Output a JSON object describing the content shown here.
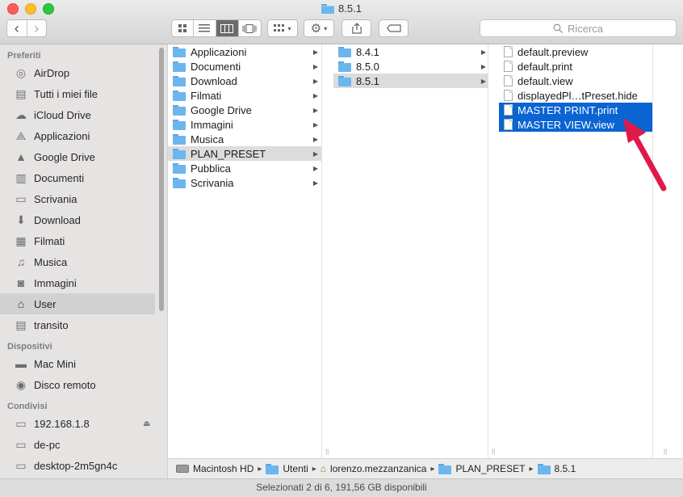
{
  "window": {
    "title": "8.5.1"
  },
  "toolbar": {
    "back": "‹",
    "forward": "›",
    "search_placeholder": "Ricerca"
  },
  "sidebar": {
    "sections": [
      {
        "header": "Preferiti",
        "items": [
          {
            "label": "AirDrop",
            "icon": "airdrop-icon",
            "glyph": "◎"
          },
          {
            "label": "Tutti i miei file",
            "icon": "all-files-icon",
            "glyph": "▤"
          },
          {
            "label": "iCloud Drive",
            "icon": "cloud-icon",
            "glyph": "☁"
          },
          {
            "label": "Applicazioni",
            "icon": "applications-icon",
            "glyph": "⟁"
          },
          {
            "label": "Google Drive",
            "icon": "google-drive-icon",
            "glyph": "▲"
          },
          {
            "label": "Documenti",
            "icon": "documents-icon",
            "glyph": "▥"
          },
          {
            "label": "Scrivania",
            "icon": "desktop-icon",
            "glyph": "▭"
          },
          {
            "label": "Download",
            "icon": "download-icon",
            "glyph": "⬇"
          },
          {
            "label": "Filmati",
            "icon": "movies-icon",
            "glyph": "▦"
          },
          {
            "label": "Musica",
            "icon": "music-icon",
            "glyph": "♫"
          },
          {
            "label": "Immagini",
            "icon": "pictures-icon",
            "glyph": "◙"
          },
          {
            "label": "User",
            "icon": "home-icon",
            "glyph": "⌂"
          },
          {
            "label": "transito",
            "icon": "folder-icon",
            "glyph": "▤"
          }
        ]
      },
      {
        "header": "Dispositivi",
        "items": [
          {
            "label": "Mac Mini",
            "icon": "computer-icon",
            "glyph": "▬"
          },
          {
            "label": "Disco remoto",
            "icon": "remote-disc-icon",
            "glyph": "◉"
          }
        ]
      },
      {
        "header": "Condivisi",
        "items": [
          {
            "label": "192.168.1.8",
            "icon": "network-display-icon",
            "glyph": "▭"
          },
          {
            "label": "de-pc",
            "icon": "network-display-icon",
            "glyph": "▭"
          },
          {
            "label": "desktop-2m5gn4c",
            "icon": "network-display-icon",
            "glyph": "▭"
          }
        ]
      }
    ]
  },
  "columns": [
    {
      "items": [
        {
          "label": "Applicazioni",
          "sel": ""
        },
        {
          "label": "Documenti",
          "sel": ""
        },
        {
          "label": "Download",
          "sel": ""
        },
        {
          "label": "Filmati",
          "sel": ""
        },
        {
          "label": "Google Drive",
          "sel": ""
        },
        {
          "label": "Immagini",
          "sel": ""
        },
        {
          "label": "Musica",
          "sel": ""
        },
        {
          "label": "PLAN_PRESET",
          "sel": "gray"
        },
        {
          "label": "Pubblica",
          "sel": ""
        },
        {
          "label": "Scrivania",
          "sel": ""
        }
      ]
    },
    {
      "items": [
        {
          "label": "8.4.1",
          "sel": ""
        },
        {
          "label": "8.5.0",
          "sel": ""
        },
        {
          "label": "8.5.1",
          "sel": "gray"
        }
      ]
    },
    {
      "items": [
        {
          "label": "default.preview",
          "sel": ""
        },
        {
          "label": "default.print",
          "sel": ""
        },
        {
          "label": "default.view",
          "sel": ""
        },
        {
          "label": "displayedPl…tPreset.hide",
          "sel": ""
        },
        {
          "label": "MASTER PRINT.print",
          "sel": "blue"
        },
        {
          "label": "MASTER VIEW.view",
          "sel": "blue"
        }
      ]
    }
  ],
  "pathbar": [
    "Macintosh HD",
    "Utenti",
    "lorenzo.mezzanzanica",
    "PLAN_PRESET",
    "8.5.1"
  ],
  "status": "Selezionati 2 di 6, 191,56 GB disponibili",
  "colors": {
    "selection_blue": "#0a64d2",
    "arrow_red": "#e0194b"
  }
}
